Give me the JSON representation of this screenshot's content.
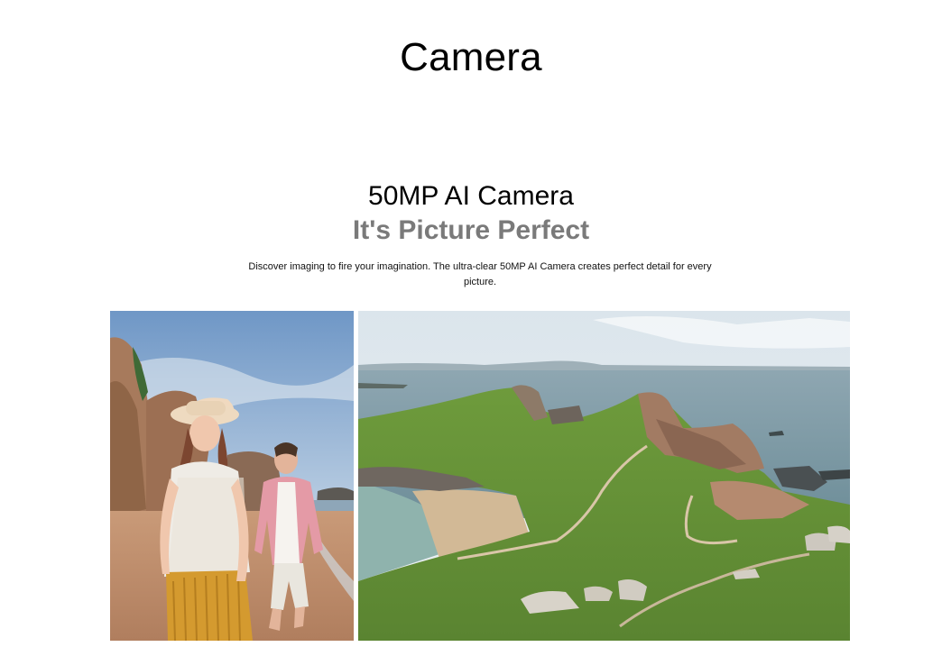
{
  "section": {
    "title": "Camera"
  },
  "feature": {
    "headline": "50MP AI Camera",
    "subheadline": "It's Picture Perfect",
    "description": "Discover imaging to fire your imagination. The ultra-clear 50MP AI Camera creates perfect detail for every picture."
  },
  "gallery": {
    "images": [
      {
        "name": "portrait-couple-beach-photo"
      },
      {
        "name": "coastal-cliff-landscape-photo"
      }
    ]
  },
  "colors": {
    "text": "#000000",
    "subheadline": "#7a7a7a",
    "background": "#ffffff"
  }
}
